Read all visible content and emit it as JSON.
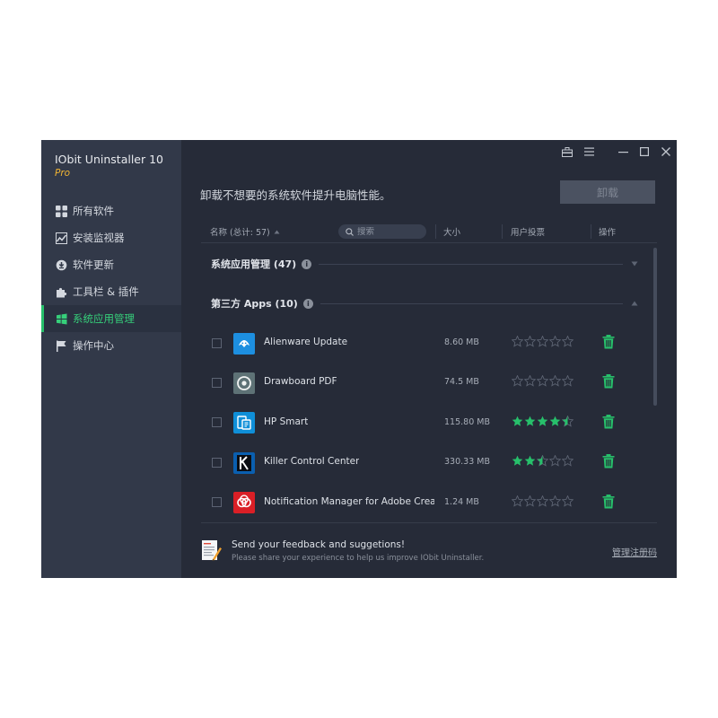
{
  "app": {
    "title": "IObit Uninstaller 10",
    "edition": "Pro"
  },
  "sidebar": {
    "items": [
      {
        "label": "所有软件",
        "icon": "grid-icon",
        "active": false
      },
      {
        "label": "安装监视器",
        "icon": "monitor-chart-icon",
        "active": false
      },
      {
        "label": "软件更新",
        "icon": "update-icon",
        "active": false
      },
      {
        "label": "工具栏 & 插件",
        "icon": "puzzle-icon",
        "active": false
      },
      {
        "label": "系统应用管理",
        "icon": "windows-icon",
        "active": true
      },
      {
        "label": "操作中心",
        "icon": "flag-icon",
        "active": false
      }
    ]
  },
  "window_controls": [
    "toolbox-icon",
    "menu-icon",
    "minimize-icon",
    "maximize-icon",
    "close-icon"
  ],
  "main": {
    "headline": "卸载不想要的系统软件提升电脑性能。",
    "uninstall_label": "卸载",
    "columns": {
      "name": "名称 (总计: 57)",
      "search_placeholder": "搜索",
      "size": "大小",
      "rating": "用户投票",
      "action": "操作"
    },
    "groups": [
      {
        "label": "系统应用管理 (47)",
        "expanded": false
      },
      {
        "label": "第三方 Apps (10)",
        "expanded": true
      }
    ],
    "apps": [
      {
        "name": "Alienware Update",
        "size": "8.60 MB",
        "rating": 0,
        "icon": "alienware-icon"
      },
      {
        "name": "Drawboard PDF",
        "size": "74.5 MB",
        "rating": 0,
        "icon": "drawboard-icon"
      },
      {
        "name": "HP Smart",
        "size": "115.80 MB",
        "rating": 4.5,
        "icon": "hp-smart-icon"
      },
      {
        "name": "Killer Control Center",
        "size": "330.33 MB",
        "rating": 2.5,
        "icon": "killer-icon"
      },
      {
        "name": "Notification Manager for Adobe Creativ...",
        "size": "1.24 MB",
        "rating": 0,
        "icon": "adobe-cc-icon"
      }
    ]
  },
  "footer": {
    "title": "Send your feedback and suggetions!",
    "subtitle": "Please share your experience to help us improve IObit Uninstaller.",
    "link": "管理注册码"
  },
  "colors": {
    "accent": "#27c06b",
    "edition": "#f2b533",
    "sidebar": "#323949",
    "background": "#262b38"
  }
}
